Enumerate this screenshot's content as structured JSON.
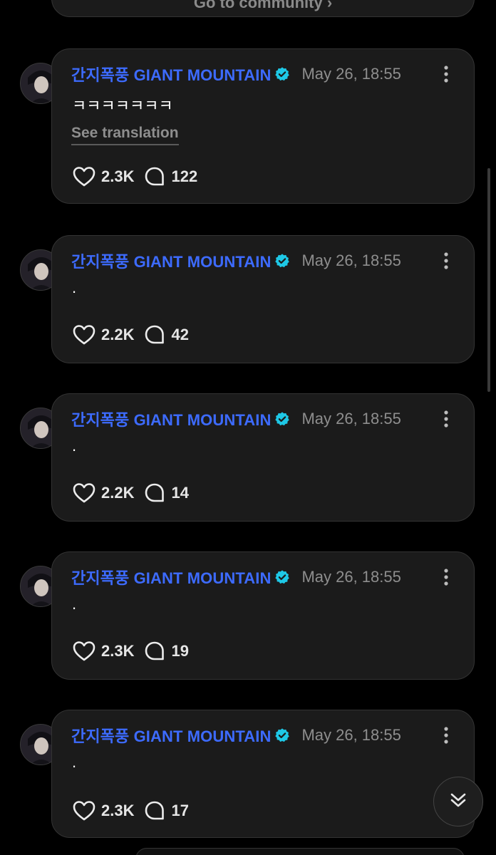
{
  "top_card": {
    "label": "Go to community ›"
  },
  "posts": [
    {
      "author": "간지폭풍 GIANT MOUNTAIN",
      "timestamp": "May 26, 18:55",
      "content": "ㅋㅋㅋㅋㅋㅋㅋ",
      "see_translation": "See translation",
      "likes": "2.3K",
      "comments": "122"
    },
    {
      "author": "간지폭풍 GIANT MOUNTAIN",
      "timestamp": "May 26, 18:55",
      "content": ".",
      "likes": "2.2K",
      "comments": "42"
    },
    {
      "author": "간지폭풍 GIANT MOUNTAIN",
      "timestamp": "May 26, 18:55",
      "content": ".",
      "likes": "2.2K",
      "comments": "14"
    },
    {
      "author": "간지폭풍 GIANT MOUNTAIN",
      "timestamp": "May 26, 18:55",
      "content": ".",
      "likes": "2.3K",
      "comments": "19"
    },
    {
      "author": "간지폭풍 GIANT MOUNTAIN",
      "timestamp": "May 26, 18:55",
      "content": ".",
      "likes": "2.3K",
      "comments": "17"
    }
  ],
  "icons": {
    "like": "heart-icon",
    "comment": "comment-bubble-icon",
    "verified": "verified-badge-icon",
    "more": "more-vertical-icon",
    "scroll_down": "double-chevron-down-icon"
  },
  "colors": {
    "background": "#000000",
    "card": "#1b1b1b",
    "author": "#3d6bff",
    "verified": "#1ec8e6",
    "muted": "#8e8e8e"
  }
}
